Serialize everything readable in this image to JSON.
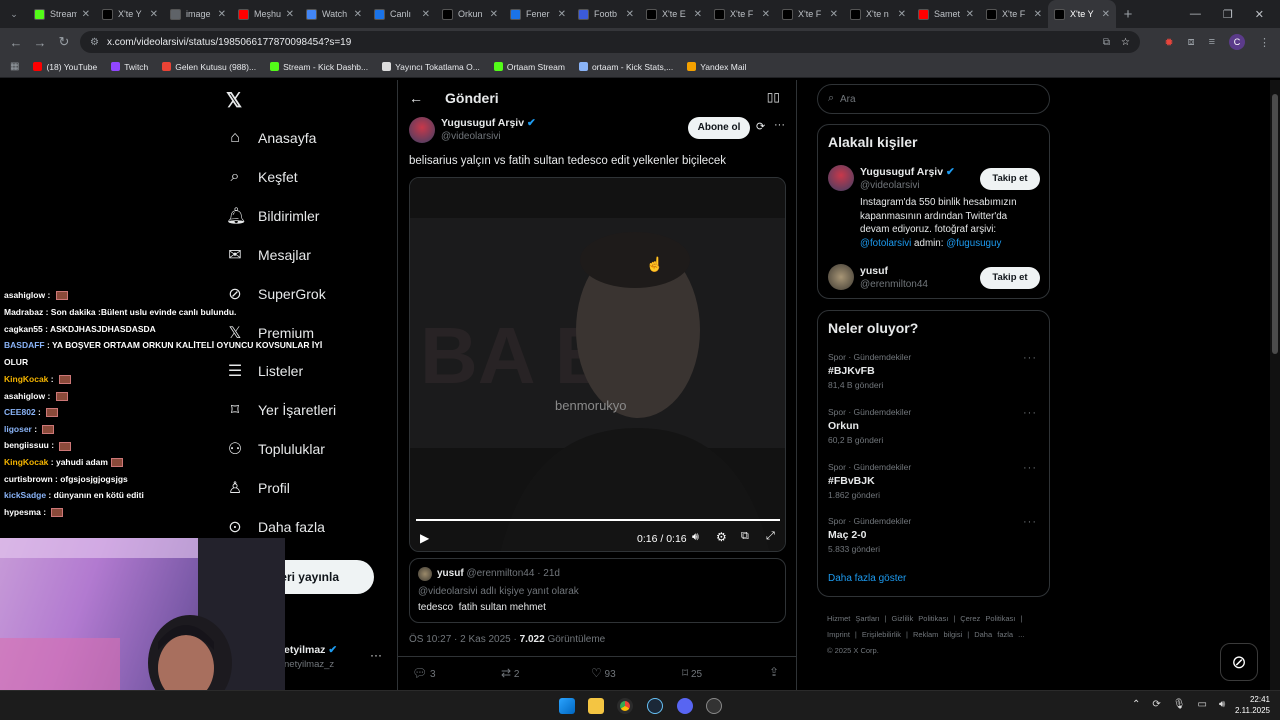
{
  "browser": {
    "tabs": [
      {
        "title": "Stream",
        "favicon": "kick-icon",
        "color": "#53fc18"
      },
      {
        "title": "X'te Y",
        "favicon": "x-icon",
        "color": "#000000"
      },
      {
        "title": "image",
        "favicon": "globe-icon",
        "color": "#5f6368"
      },
      {
        "title": "Meşhu",
        "favicon": "youtube-icon",
        "color": "#ff0000"
      },
      {
        "title": "Watch",
        "favicon": "watch-icon",
        "color": "#4285f4"
      },
      {
        "title": "Canlı",
        "favicon": "m-icon",
        "color": "#1a73e8"
      },
      {
        "title": "Orkun",
        "favicon": "x-icon",
        "color": "#000000"
      },
      {
        "title": "Fener",
        "favicon": "m-icon",
        "color": "#1a73e8"
      },
      {
        "title": "Footb",
        "favicon": "f-icon",
        "color": "#3b5bdb"
      },
      {
        "title": "X'te E",
        "favicon": "x-icon",
        "color": "#000000"
      },
      {
        "title": "X'te F",
        "favicon": "x-icon",
        "color": "#000000"
      },
      {
        "title": "X'te F",
        "favicon": "x-icon",
        "color": "#000000"
      },
      {
        "title": "X'te n",
        "favicon": "x-icon",
        "color": "#000000"
      },
      {
        "title": "Samet",
        "favicon": "youtube-icon",
        "color": "#ff0000"
      },
      {
        "title": "X'te F",
        "favicon": "x-icon",
        "color": "#000000"
      },
      {
        "title": "X'te Y",
        "favicon": "x-icon",
        "color": "#000000",
        "active": true
      }
    ],
    "url": "x.com/videolarsivi/status/1985066177870098454?s=19",
    "profile_initial": "C",
    "bookmarks": [
      {
        "label": "(18) YouTube",
        "color": "#ff0000"
      },
      {
        "label": "Twitch",
        "color": "#9146ff"
      },
      {
        "label": "Gelen Kutusu (988)...",
        "color": "#ea4335"
      },
      {
        "label": "Stream - Kick Dashb...",
        "color": "#53fc18"
      },
      {
        "label": "Yayıncı Tokatlama O...",
        "color": "#dddddd"
      },
      {
        "label": "Ortaam Stream",
        "color": "#53fc18"
      },
      {
        "label": "ortaam - Kick Stats,...",
        "color": "#8ab4f8"
      },
      {
        "label": "Yandex Mail",
        "color": "#f4a100"
      }
    ]
  },
  "nav": {
    "items": [
      "Anasayfa",
      "Keşfet",
      "Bildirimler",
      "Mesajlar",
      "SuperGrok",
      "Premium",
      "Listeler",
      "Yer İşaretleri",
      "Topluluklar",
      "Profil",
      "Daha fazla"
    ],
    "post_button": "eri yayınla",
    "account_name": "etyilmaz",
    "account_handle": "netyilmaz_z"
  },
  "post": {
    "header_title": "Gönderi",
    "author_name": "Yugusuguf Arşiv",
    "author_handle": "@videolarsivi",
    "subscribe": "Abone ol",
    "text": "belisarius yalçın vs fatih sultan tedesco edit yelkenler biçilecek",
    "watermark": "benmorukyo",
    "video_time": "0:16 / 0:16",
    "progress": 1.0,
    "reply": {
      "name": "yusuf",
      "handle": "@erenmilton44",
      "age": "· 21d",
      "context": "@videolarsivi adlı kişiye yanıt olarak",
      "text": "tedesco  fatih sultan mehmet"
    },
    "meta_time": "ÖS 10:27 · 2 Kas 2025 ·",
    "views_count": "7.022",
    "views_label": "Görüntüleme",
    "stats": {
      "replies": "3",
      "reposts": "2",
      "likes": "93",
      "bookmarks": "25"
    }
  },
  "sidebar": {
    "search_placeholder": "Ara",
    "related_title": "Alakalı kişiler",
    "people": [
      {
        "name": "Yugusuguf Arşiv",
        "handle": "@videolarsivi",
        "follow": "Takip et",
        "bio_line1": "Instagram'da 550 binlik hesabımızın",
        "bio_line2": "kapanmasının ardından Twitter'da",
        "bio_line3": "devam ediyoruz. fotoğraf arşivi:",
        "bio_link1": "@fotolarsivi",
        "bio_mid": " admin: ",
        "bio_link2": "@fugusuguy"
      },
      {
        "name": "yusuf",
        "handle": "@erenmilton44",
        "follow": "Takip et"
      }
    ],
    "trends_title": "Neler oluyor?",
    "trends": [
      {
        "meta": "Spor · Gündemdekiler",
        "name": "#BJKvFB",
        "count": "81,4 B gönderi"
      },
      {
        "meta": "Spor · Gündemdekiler",
        "name": "Orkun",
        "count": "60,2 B gönderi"
      },
      {
        "meta": "Spor · Gündemdekiler",
        "name": "#FBvBJK",
        "count": "1.862 gönderi"
      },
      {
        "meta": "Spor · Gündemdekiler",
        "name": "Maç 2-0",
        "count": "5.833 gönderi"
      }
    ],
    "show_more": "Daha fazla göster",
    "footer_line1": [
      "Hizmet Şartları",
      "|",
      "Gizlilik Politikası",
      "|",
      "Çerez Politikası",
      "|"
    ],
    "footer_line2": [
      "Imprint",
      "|",
      "Erişilebilirlik",
      "|",
      "Reklam bilgisi",
      "|",
      "Daha fazla ..."
    ],
    "copyright": "© 2025 X Corp."
  },
  "chat": [
    {
      "user": "asahiglow",
      "color": "#ffffff",
      "msg": "",
      "emote": true
    },
    {
      "user": "Madrabaz",
      "color": "#ffffff",
      "msg": "Son dakika :Bülent uslu evinde canlı bulundu.",
      "emote": false
    },
    {
      "user": "cagkan55",
      "color": "#ffffff",
      "msg": "ASKDJHASJDHASDASDA",
      "emote": false
    },
    {
      "user": "BASDAFF",
      "color": "#8ab4f8",
      "msg": "YA BOŞVER ORTAAM ORKUN KALİTELİ OYUNCU KOVSUNLAR İYİ",
      "emote": false
    },
    {
      "user": "",
      "color": "#ffffff",
      "msg": "OLUR",
      "emote": false
    },
    {
      "user": "KingKocak",
      "color": "#f4b400",
      "msg": "",
      "emote": true
    },
    {
      "user": "asahiglow",
      "color": "#ffffff",
      "msg": "",
      "emote": true
    },
    {
      "user": "CEE802",
      "color": "#8ab4f8",
      "msg": "",
      "emote": true
    },
    {
      "user": "ligoser",
      "color": "#8ab4f8",
      "msg": "",
      "emote": true
    },
    {
      "user": "bengiissuu",
      "color": "#ffffff",
      "msg": "",
      "emote": true
    },
    {
      "user": "KingKocak",
      "color": "#f4b400",
      "msg": "yahudi adam",
      "emote": true
    },
    {
      "user": "curtisbrown",
      "color": "#ffffff",
      "msg": "ofgsjosjgjogsjgs",
      "emote": false
    },
    {
      "user": "kickSadge",
      "color": "#8ab4f8",
      "msg": "dünyanın en kötü editi",
      "emote": false
    },
    {
      "user": "hypesma",
      "color": "#ffffff",
      "msg": "",
      "emote": true
    }
  ],
  "taskbar": {
    "time": "22:41",
    "date": "2.11.2025"
  }
}
